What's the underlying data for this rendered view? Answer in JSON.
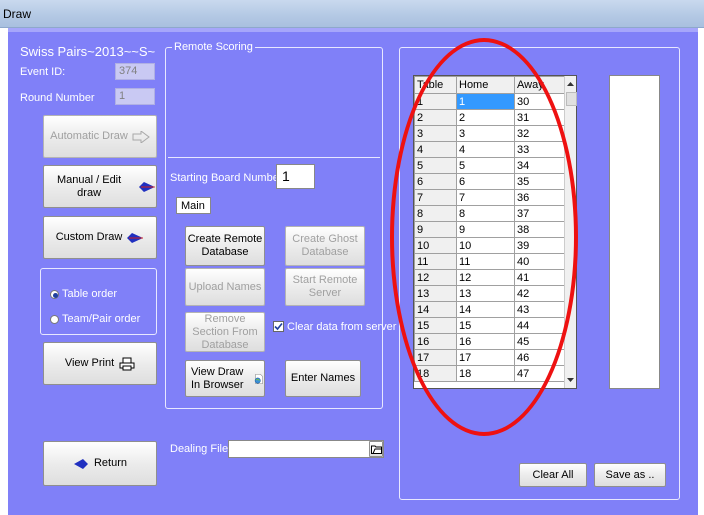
{
  "window": {
    "title": "Draw"
  },
  "left": {
    "event_title": "Swiss Pairs~2013~~S~",
    "event_id_label": "Event ID:",
    "event_id_value": "374",
    "round_label": "Round Number",
    "round_value": "1",
    "automatic_draw": "Automatic Draw",
    "manual_draw": "Manual / Edit draw",
    "custom_draw": "Custom Draw",
    "table_order": "Table order",
    "team_order": "Team/Pair order",
    "view_print": "View Print",
    "return": "Return"
  },
  "remote": {
    "title": "Remote Scoring",
    "starting_board_label": "Starting Board Number",
    "starting_board_value": "1",
    "section": "Main",
    "create_remote_db": "Create Remote Database",
    "create_ghost_db": "Create Ghost Database",
    "upload_names": "Upload Names",
    "start_remote_server": "Start Remote Server",
    "remove_section": "Remove Section From Database",
    "clear_data": "Clear data from server",
    "view_draw_browser": "View Draw In Browser",
    "enter_names": "Enter Names"
  },
  "dealing": {
    "label": "Dealing File:",
    "value": ""
  },
  "grid": {
    "columns": [
      "Table",
      "Home",
      "Away"
    ],
    "rows": [
      [
        "1",
        "1",
        "30"
      ],
      [
        "2",
        "2",
        "31"
      ],
      [
        "3",
        "3",
        "32"
      ],
      [
        "4",
        "4",
        "33"
      ],
      [
        "5",
        "5",
        "34"
      ],
      [
        "6",
        "6",
        "35"
      ],
      [
        "7",
        "7",
        "36"
      ],
      [
        "8",
        "8",
        "37"
      ],
      [
        "9",
        "9",
        "38"
      ],
      [
        "10",
        "10",
        "39"
      ],
      [
        "11",
        "11",
        "40"
      ],
      [
        "12",
        "12",
        "41"
      ],
      [
        "13",
        "13",
        "42"
      ],
      [
        "14",
        "14",
        "43"
      ],
      [
        "15",
        "15",
        "44"
      ],
      [
        "16",
        "16",
        "45"
      ],
      [
        "17",
        "17",
        "46"
      ],
      [
        "18",
        "18",
        "47"
      ]
    ]
  },
  "bottom_right": {
    "clear_all": "Clear All",
    "save_as": "Save as .."
  },
  "colors": {
    "background": "#8080f8",
    "selection": "#3399ff",
    "annotation": "#ee1111"
  }
}
